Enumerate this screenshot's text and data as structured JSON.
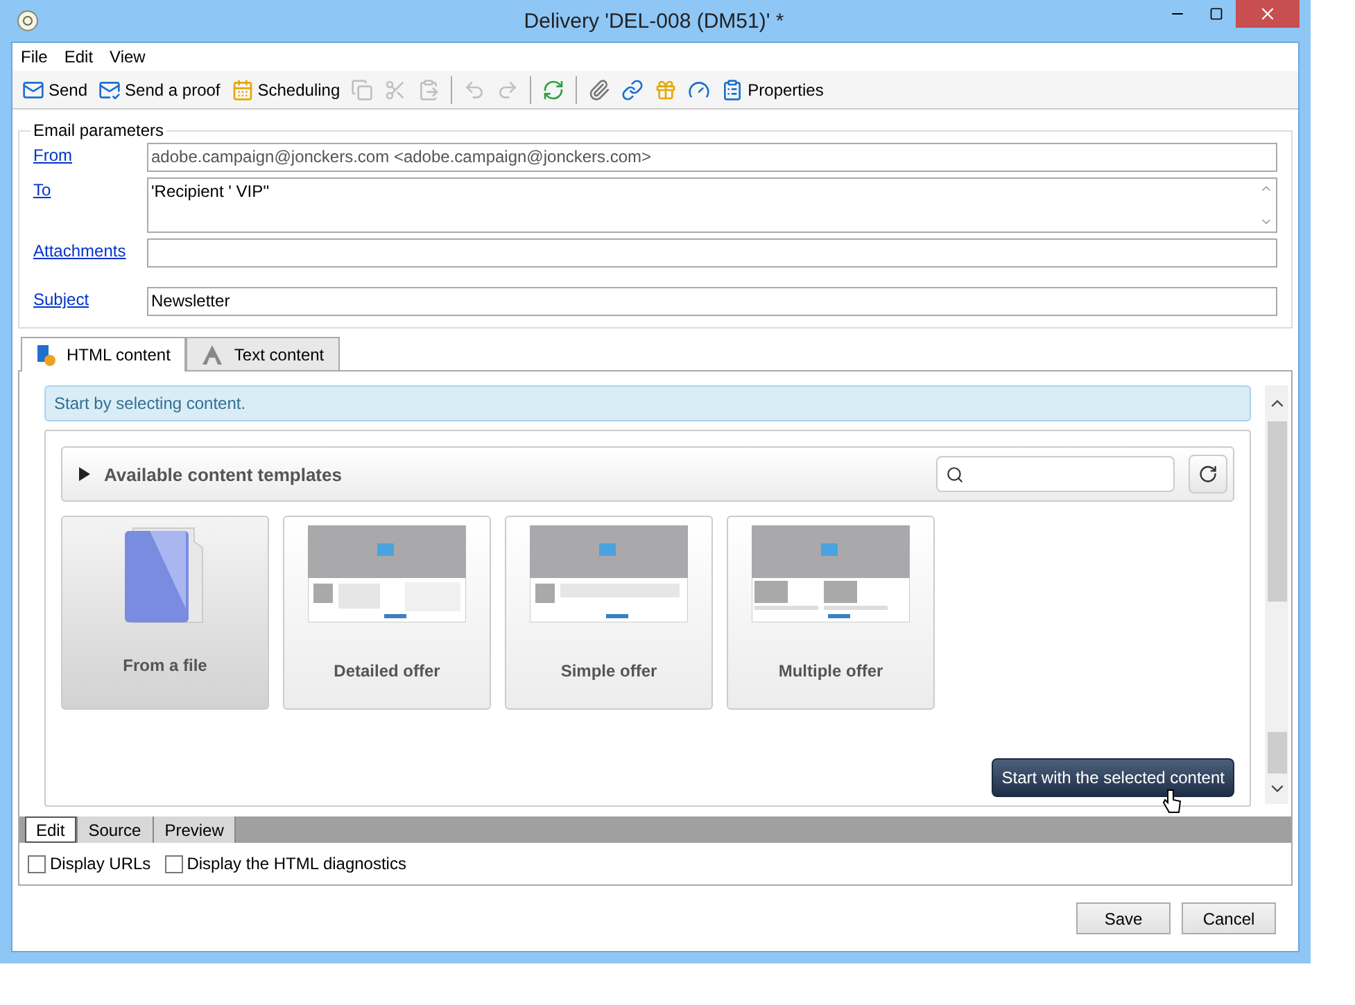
{
  "window": {
    "title": "Delivery 'DEL-008 (DM51)' *"
  },
  "menu": [
    "File",
    "Edit",
    "View"
  ],
  "toolbar": [
    {
      "kind": "button",
      "label": "Send",
      "disabled": false
    },
    {
      "kind": "button",
      "label": "Send a proof",
      "disabled": false
    },
    {
      "kind": "button",
      "label": "Scheduling",
      "disabled": false
    },
    {
      "kind": "button",
      "disabled": true
    },
    {
      "kind": "button",
      "disabled": true
    },
    {
      "kind": "button",
      "disabled": true
    },
    {
      "kind": "separator"
    },
    {
      "kind": "button",
      "disabled": true
    },
    {
      "kind": "button",
      "disabled": true
    },
    {
      "kind": "separator"
    },
    {
      "kind": "button",
      "disabled": false
    },
    {
      "kind": "separator"
    },
    {
      "kind": "button",
      "disabled": false
    },
    {
      "kind": "button",
      "disabled": false
    },
    {
      "kind": "button",
      "disabled": false
    },
    {
      "kind": "button",
      "disabled": false
    },
    {
      "kind": "button",
      "label": "Properties",
      "disabled": false
    }
  ],
  "email_parameters": {
    "legend": "Email parameters",
    "fields": [
      {
        "label": "From",
        "kind": "line",
        "value": "adobe.campaign@jonckers.com <adobe.campaign@jonckers.com>"
      },
      {
        "label": "To",
        "kind": "multiline",
        "value": "'Recipient ' VIP''"
      },
      {
        "label": "Attachments",
        "kind": "line"
      },
      {
        "label": "Subject",
        "kind": "line",
        "value": "Newsletter"
      }
    ]
  },
  "content_tabs": [
    {
      "label": "HTML content",
      "selected": true
    },
    {
      "label": "Text content",
      "selected": false
    }
  ],
  "banner": "Start by selecting content.",
  "templates": {
    "title": "Available content templates",
    "cards": [
      {
        "label": "From a file",
        "kind": "folder",
        "selected": true
      },
      {
        "label": "Detailed offer",
        "kind": "detailed",
        "selected": false
      },
      {
        "label": "Simple offer",
        "kind": "simple",
        "selected": false
      },
      {
        "label": "Multiple offer",
        "kind": "multiple",
        "selected": false
      }
    ]
  },
  "start_button": "Start with the selected content",
  "editor_tabs": [
    {
      "label": "Edit",
      "selected": true
    },
    {
      "label": "Source",
      "selected": false
    },
    {
      "label": "Preview",
      "selected": false
    }
  ],
  "options": [
    {
      "label": "Display URLs",
      "checked": false
    },
    {
      "label": "Display the HTML diagnostics",
      "checked": false
    }
  ],
  "buttons": [
    "Save",
    "Cancel"
  ]
}
